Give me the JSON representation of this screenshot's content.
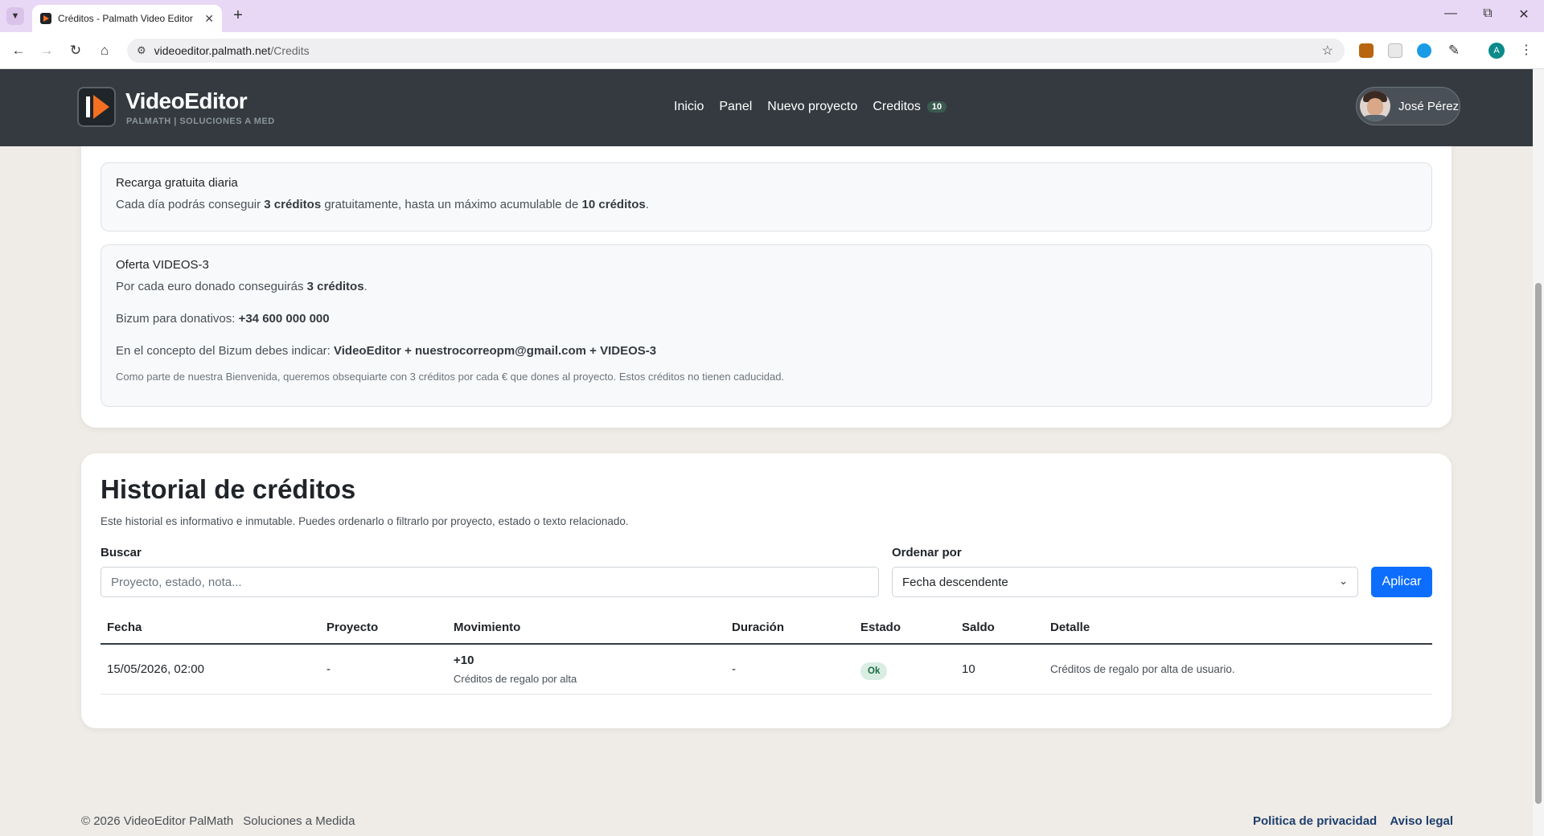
{
  "browser": {
    "tab_title": "Créditos - Palmath Video Editor",
    "url_host": "videoeditor.palmath.net",
    "url_path": "/Credits",
    "profile_initial": "A"
  },
  "header": {
    "brand_name": "VideoEditor",
    "brand_tagline": "PALMATH | SOLUCIONES A MED",
    "nav": {
      "inicio": "Inicio",
      "panel": "Panel",
      "nuevo_proyecto": "Nuevo proyecto",
      "creditos": "Creditos",
      "credit_count": "10"
    },
    "user_name": "José Pérez"
  },
  "offers": {
    "daily": {
      "title": "Recarga gratuita diaria",
      "text_1": "Cada día podrás conseguir ",
      "bold_1": "3 créditos",
      "text_2": " gratuitamente, hasta un máximo acumulable de ",
      "bold_2": "10 créditos",
      "text_3": "."
    },
    "videos3": {
      "title": "Oferta VIDEOS-3",
      "line1_text": "Por cada euro donado conseguirás ",
      "line1_bold": "3 créditos",
      "line1_end": ".",
      "line2_text": "Bizum para donativos: ",
      "line2_bold": "+34 600 000 000",
      "line3_text": "En el concepto del Bizum debes indicar: ",
      "line3_bold": "VideoEditor + nuestrocorreopm@gmail.com + VIDEOS-3",
      "note": "Como parte de nuestra Bienvenida, queremos obsequiarte con 3 créditos por cada € que dones al proyecto. Estos créditos no tienen caducidad."
    }
  },
  "history": {
    "title": "Historial de créditos",
    "subtitle": "Este historial es informativo e inmutable. Puedes ordenarlo o filtrarlo por proyecto, estado o texto relacionado.",
    "search_label": "Buscar",
    "search_placeholder": "Proyecto, estado, nota...",
    "order_label": "Ordenar por",
    "order_value": "Fecha descendente",
    "apply_label": "Aplicar",
    "columns": {
      "fecha": "Fecha",
      "proyecto": "Proyecto",
      "movimiento": "Movimiento",
      "duracion": "Duración",
      "estado": "Estado",
      "saldo": "Saldo",
      "detalle": "Detalle"
    },
    "rows": [
      {
        "fecha": "15/05/2026, 02:00",
        "proyecto": "-",
        "movimiento": "+10",
        "movimiento_sub": "Créditos de regalo por alta",
        "duracion": "-",
        "estado": "Ok",
        "saldo": "10",
        "detalle": "Créditos de regalo por alta de usuario."
      }
    ]
  },
  "footer": {
    "copyright": "© 2026 VideoEditor PalMath",
    "tagline": "Soluciones a Medida",
    "privacy": "Politica de privacidad",
    "legal": "Aviso legal"
  },
  "colors": {
    "header_bg": "#343a40",
    "accent_orange": "#f36f21",
    "primary_blue": "#0d6efd",
    "ok_badge_bg": "#d9ede3",
    "footer_link": "#1d3f6e"
  }
}
